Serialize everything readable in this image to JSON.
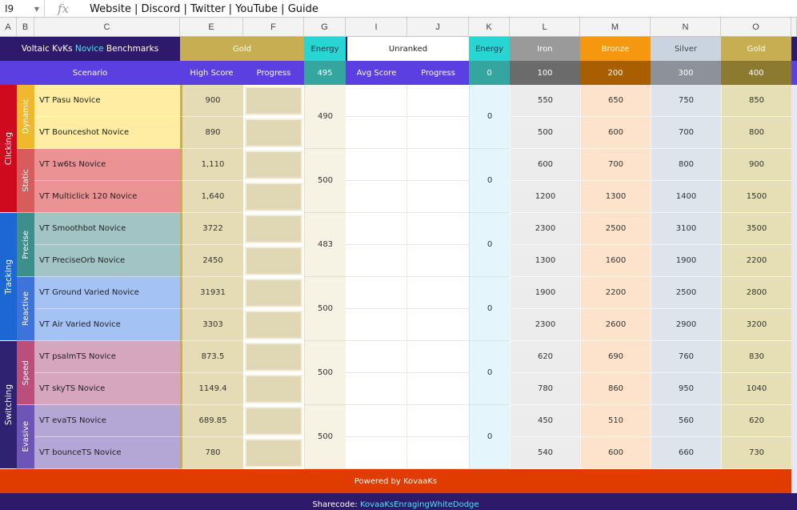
{
  "formula_bar": {
    "name_box": "I9",
    "fx_label": "fx",
    "content": "Website | Discord | Twitter | YouTube | Guide"
  },
  "columns": [
    "A",
    "B",
    "C",
    "E",
    "F",
    "G",
    "I",
    "J",
    "K",
    "L",
    "M",
    "N",
    "O"
  ],
  "header": {
    "title_pre": "Voltaic KvKs ",
    "title_mid": "Novice",
    "title_post": " Benchmarks",
    "gold": "Gold",
    "energy": "Energy",
    "unranked": "Unranked",
    "energy2": "Energy",
    "ranks": [
      "Iron",
      "Bronze",
      "Silver",
      "Gold"
    ]
  },
  "subheader": {
    "scenario": "Scenario",
    "high_score": "High Score",
    "progress": "Progress",
    "energy_value": "495",
    "avg_score": "Avg Score",
    "progress2": "Progress",
    "unranked_energy": "0",
    "thresholds": [
      "100",
      "200",
      "300",
      "400"
    ]
  },
  "categories": [
    {
      "name": "Clicking",
      "subs": [
        {
          "name": "Dynamic",
          "energy": "490",
          "unranked_energy": "0",
          "scenarios": [
            {
              "name": "VT Pasu Novice",
              "score": "900",
              "req": [
                "550",
                "650",
                "750",
                "850"
              ]
            },
            {
              "name": "VT Bounceshot Novice",
              "score": "890",
              "req": [
                "500",
                "600",
                "700",
                "800"
              ]
            }
          ]
        },
        {
          "name": "Static",
          "energy": "500",
          "unranked_energy": "0",
          "scenarios": [
            {
              "name": "VT 1w6ts Novice",
              "score": "1,110",
              "req": [
                "600",
                "700",
                "800",
                "900"
              ]
            },
            {
              "name": "VT Multiclick 120 Novice",
              "score": "1,640",
              "req": [
                "1200",
                "1300",
                "1400",
                "1500"
              ]
            }
          ]
        }
      ]
    },
    {
      "name": "Tracking",
      "subs": [
        {
          "name": "Precise",
          "energy": "483",
          "unranked_energy": "0",
          "scenarios": [
            {
              "name": "VT Smoothbot Novice",
              "score": "3722",
              "req": [
                "2300",
                "2500",
                "3100",
                "3500"
              ]
            },
            {
              "name": "VT PreciseOrb Novice",
              "score": "2450",
              "req": [
                "1300",
                "1600",
                "1900",
                "2200"
              ]
            }
          ]
        },
        {
          "name": "Reactive",
          "energy": "500",
          "unranked_energy": "0",
          "scenarios": [
            {
              "name": "VT Ground Varied Novice",
              "score": "31931",
              "req": [
                "1900",
                "2200",
                "2500",
                "2800"
              ]
            },
            {
              "name": "VT Air Varied Novice",
              "score": "3303",
              "req": [
                "2300",
                "2600",
                "2900",
                "3200"
              ]
            }
          ]
        }
      ]
    },
    {
      "name": "Switching",
      "subs": [
        {
          "name": "Speed",
          "energy": "500",
          "unranked_energy": "0",
          "scenarios": [
            {
              "name": "VT psalmTS Novice",
              "score": "873.5",
              "req": [
                "620",
                "690",
                "760",
                "830"
              ]
            },
            {
              "name": "VT skyTS Novice",
              "score": "1149.4",
              "req": [
                "780",
                "860",
                "950",
                "1040"
              ]
            }
          ]
        },
        {
          "name": "Evasive",
          "energy": "500",
          "unranked_energy": "0",
          "scenarios": [
            {
              "name": "VT evaTS Novice",
              "score": "689.85",
              "req": [
                "450",
                "510",
                "560",
                "620"
              ]
            },
            {
              "name": "VT bounceTS Novice",
              "score": "780",
              "req": [
                "540",
                "600",
                "660",
                "730"
              ]
            }
          ]
        }
      ]
    }
  ],
  "footer": {
    "powered": "Powered by KovaaKs",
    "sharecode_label": "Sharecode: ",
    "sharecode_value": "KovaaKsEnragingWhiteDodge"
  },
  "colors": {
    "header_purple": "#2e1a6b",
    "sub_purple": "#5b3fe0",
    "gold_header": "#c8ae52",
    "energy_cyan": "#27d6d2",
    "energy_sub": "#35a5a0",
    "iron": "#9a9a9a",
    "bronze": "#f5980f",
    "silver": "#c9d4e0",
    "footer_red": "#e03c00",
    "sharecode_cyan": "#4fe3f0",
    "cat_clicking": "#d00a1e",
    "cat_tracking": "#1d67d4",
    "cat_switching": "#2f2270",
    "sub_dynamic": "#efb82d",
    "sub_static": "#d85c5c",
    "sub_precise": "#3d8f8c",
    "sub_reactive": "#3e74d9",
    "sub_speed": "#b94f7a",
    "sub_evasive": "#6d55b8",
    "row_dynamic": "#feeda3",
    "row_static": "#ea9294",
    "row_precise": "#a2c4c5",
    "row_reactive": "#a4c2f4",
    "row_speed": "#d5a6bd",
    "row_evasive": "#b4a7d6"
  }
}
